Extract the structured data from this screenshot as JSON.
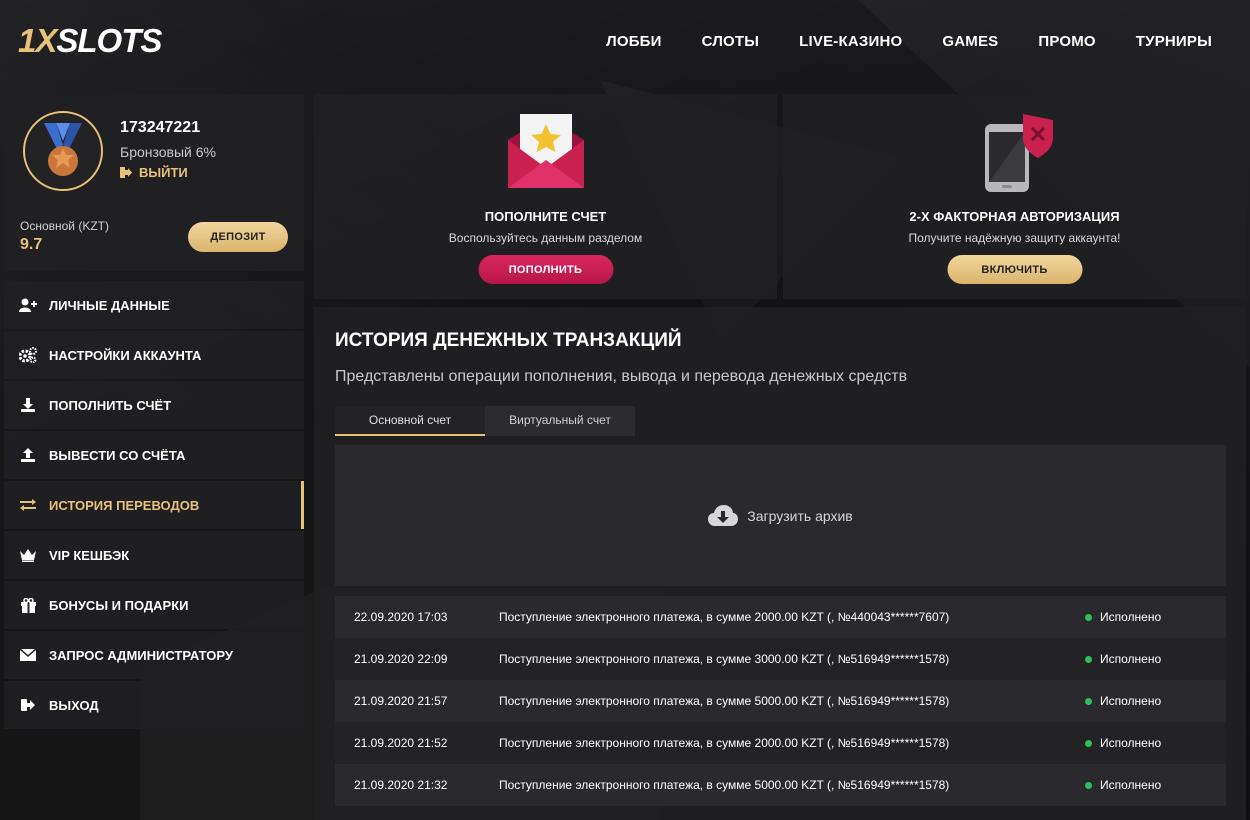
{
  "header": {
    "logo_part1": "1X",
    "logo_part2": "SLOTS",
    "nav": [
      "ЛОББИ",
      "СЛОТЫ",
      "LIVE-КАЗИНО",
      "GAMES",
      "ПРОМО",
      "ТУРНИРЫ"
    ]
  },
  "profile": {
    "id": "173247221",
    "level": "Бронзовый 6%",
    "logout_label": "ВЫЙТИ",
    "balance_label": "Основной (KZT)",
    "balance_value": "9.7",
    "deposit_label": "ДЕПОЗИТ"
  },
  "menu": [
    {
      "label": "ЛИЧНЫЕ ДАННЫЕ",
      "icon": "user-plus-icon"
    },
    {
      "label": "НАСТРОЙКИ АККАУНТА",
      "icon": "gears-icon"
    },
    {
      "label": "ПОПОЛНИТЬ СЧЁТ",
      "icon": "download-icon"
    },
    {
      "label": "ВЫВЕСТИ СО СЧЁТА",
      "icon": "upload-icon"
    },
    {
      "label": "ИСТОРИЯ ПЕРЕВОДОВ",
      "icon": "exchange-icon",
      "active": true
    },
    {
      "label": "VIP КЕШБЭК",
      "icon": "crown-icon"
    },
    {
      "label": "БОНУСЫ И ПОДАРКИ",
      "icon": "gift-icon"
    },
    {
      "label": "ЗАПРОС АДМИНИСТРАТОРУ",
      "icon": "envelope-icon"
    },
    {
      "label": "ВЫХОД",
      "icon": "sign-out-icon"
    }
  ],
  "cards": [
    {
      "title": "ПОПОЛНИТЕ СЧЕТ",
      "subtitle": "Воспользуйтесь данным разделом",
      "button": "ПОПОЛНИТЬ",
      "icon": "envelope-star-icon"
    },
    {
      "title": "2-Х ФАКТОРНАЯ АВТОРИЗАЦИЯ",
      "subtitle": "Получите надёжную защиту аккаунта!",
      "button": "ВКЛЮЧИТЬ",
      "icon": "phone-shield-icon"
    }
  ],
  "history": {
    "title": "ИСТОРИЯ ДЕНЕЖНЫХ ТРАНЗАКЦИЙ",
    "description": "Представлены операции пополнения, вывода и перевода денежных средств",
    "tabs": [
      "Основной счет",
      "Виртуальный счет"
    ],
    "archive_label": "Загрузить архив",
    "rows": [
      {
        "date": "22.09.2020 17:03",
        "desc": "Поступление электронного платежа, в сумме 2000.00 KZT (, №440043******7607)",
        "status": "Исполнено"
      },
      {
        "date": "21.09.2020 22:09",
        "desc": "Поступление электронного платежа, в сумме 3000.00 KZT (, №516949******1578)",
        "status": "Исполнено"
      },
      {
        "date": "21.09.2020 21:57",
        "desc": "Поступление электронного платежа, в сумме 5000.00 KZT (, №516949******1578)",
        "status": "Исполнено"
      },
      {
        "date": "21.09.2020 21:52",
        "desc": "Поступление электронного платежа, в сумме 2000.00 KZT (, №516949******1578)",
        "status": "Исполнено"
      },
      {
        "date": "21.09.2020 21:32",
        "desc": "Поступление электронного платежа, в сумме 5000.00 KZT (, №516949******1578)",
        "status": "Исполнено"
      }
    ]
  },
  "colors": {
    "accent": "#e6c27a",
    "pink": "#c81b52",
    "status_ok": "#2fbf5a"
  }
}
